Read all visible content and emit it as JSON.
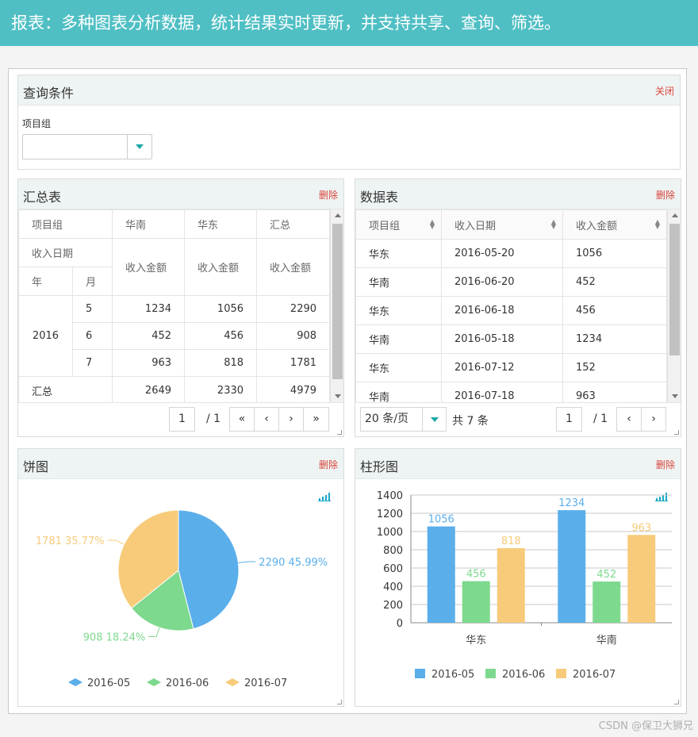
{
  "banner": "报表：多种图表分析数据，统计结果实时更新，并支持共享、查询、筛选。",
  "query": {
    "title": "查询条件",
    "action": "关闭",
    "label": "项目组",
    "value": ""
  },
  "summary": {
    "title": "汇总表",
    "action": "删除",
    "h_group": "项目组",
    "h_south": "华南",
    "h_east": "华东",
    "h_total": "汇总",
    "h_date": "收入日期",
    "h_amount": "收入金额",
    "h_year": "年",
    "h_month": "月",
    "year": "2016",
    "rows": [
      {
        "month": "5",
        "south": "1234",
        "east": "1056",
        "total": "2290"
      },
      {
        "month": "6",
        "south": "452",
        "east": "456",
        "total": "908"
      },
      {
        "month": "7",
        "south": "963",
        "east": "818",
        "total": "1781"
      }
    ],
    "footer": {
      "label": "汇总",
      "south": "2649",
      "east": "2330",
      "total": "4979"
    },
    "pager": {
      "page": "1",
      "of": "/ 1",
      "first": "«",
      "prev": "‹",
      "next": "›",
      "last": "»"
    }
  },
  "datatable": {
    "title": "数据表",
    "action": "删除",
    "columns": [
      "项目组",
      "收入日期",
      "收入金额"
    ],
    "rows": [
      [
        "华东",
        "2016-05-20",
        "1056"
      ],
      [
        "华南",
        "2016-06-20",
        "452"
      ],
      [
        "华东",
        "2016-06-18",
        "456"
      ],
      [
        "华南",
        "2016-05-18",
        "1234"
      ],
      [
        "华东",
        "2016-07-12",
        "152"
      ],
      [
        "华南",
        "2016-07-18",
        "963"
      ]
    ],
    "pager": {
      "page_size": "20 条/页",
      "total": "共 7 条",
      "page": "1",
      "of": "/ 1",
      "prev": "‹",
      "next": "›"
    }
  },
  "pie": {
    "title": "饼图",
    "action": "删除"
  },
  "bar": {
    "title": "柱形图",
    "action": "删除"
  },
  "colors": {
    "may": "#5aaeea",
    "jun": "#7dd98e",
    "jul": "#f7cb7a"
  },
  "chart_data": [
    {
      "type": "pie",
      "slices": [
        {
          "name": "2016-05",
          "value": 2290,
          "label": "2290 45.99%"
        },
        {
          "name": "2016-06",
          "value": 908,
          "label": "908 18.24%"
        },
        {
          "name": "2016-07",
          "value": 1781,
          "label": "1781 35.77%"
        }
      ],
      "legend": [
        "2016-05",
        "2016-06",
        "2016-07"
      ]
    },
    {
      "type": "bar",
      "categories": [
        "华东",
        "华南"
      ],
      "series": [
        {
          "name": "2016-05",
          "values": [
            1056,
            1234
          ]
        },
        {
          "name": "2016-06",
          "values": [
            456,
            452
          ]
        },
        {
          "name": "2016-07",
          "values": [
            818,
            963
          ]
        }
      ],
      "ylim": [
        0,
        1400
      ],
      "yticks": [
        "0",
        "200",
        "400",
        "600",
        "800",
        "1000",
        "1200",
        "1400"
      ],
      "grid": true,
      "legend": "bottom"
    }
  ],
  "watermark": "CSDN @保卫大狮兄"
}
